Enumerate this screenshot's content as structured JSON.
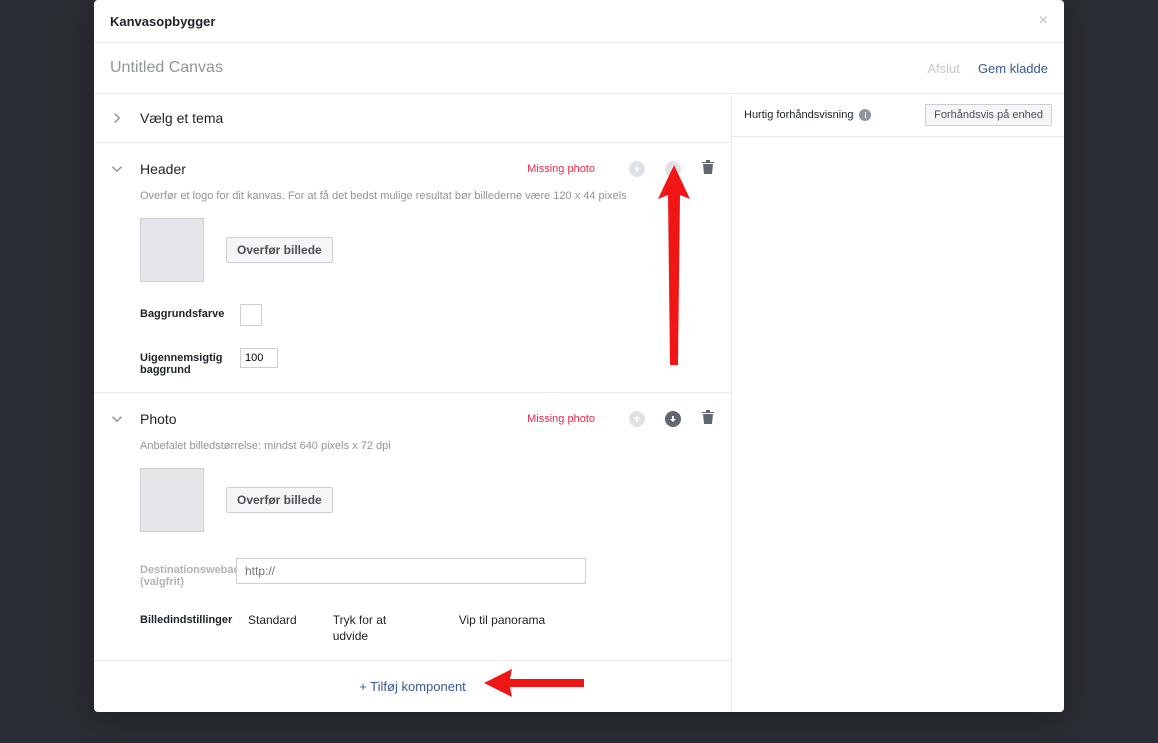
{
  "modal": {
    "title": "Kanvasopbygger",
    "close_symbol": "×"
  },
  "canvas": {
    "title": "Untitled Canvas"
  },
  "actions": {
    "finish": "Afslut",
    "save_draft": "Gem kladde"
  },
  "theme": {
    "label": "Vælg et tema"
  },
  "header_section": {
    "title": "Header",
    "warning": "Missing photo",
    "helper": "Overfør et logo for dit kanvas. For at få det bedst mulige resultat bør billederne være 120 x 44 pixels",
    "upload_btn": "Overfør billede",
    "bgcolor_label": "Baggrundsfarve",
    "opacity_label": "Uigennemsigtig baggrund",
    "opacity_value": "100"
  },
  "photo_section": {
    "title": "Photo",
    "warning": "Missing photo",
    "helper": "Anbefalet billedstørrelse: mindst 640 pixels x 72 dpi",
    "upload_btn": "Overfør billede",
    "url_label": "Destinationswebadresse (valgfrit)",
    "url_placeholder": "http://",
    "opts_label": "Billedindstillinger",
    "opt_standard": "Standard",
    "opt_expand": "Tryk for at udvide",
    "opt_pano": "Vip til panorama"
  },
  "add_component": {
    "label": "+ Tilføj komponent"
  },
  "preview": {
    "title": "Hurtig forhåndsvisning",
    "device_btn": "Forhåndsvis på enhed"
  }
}
